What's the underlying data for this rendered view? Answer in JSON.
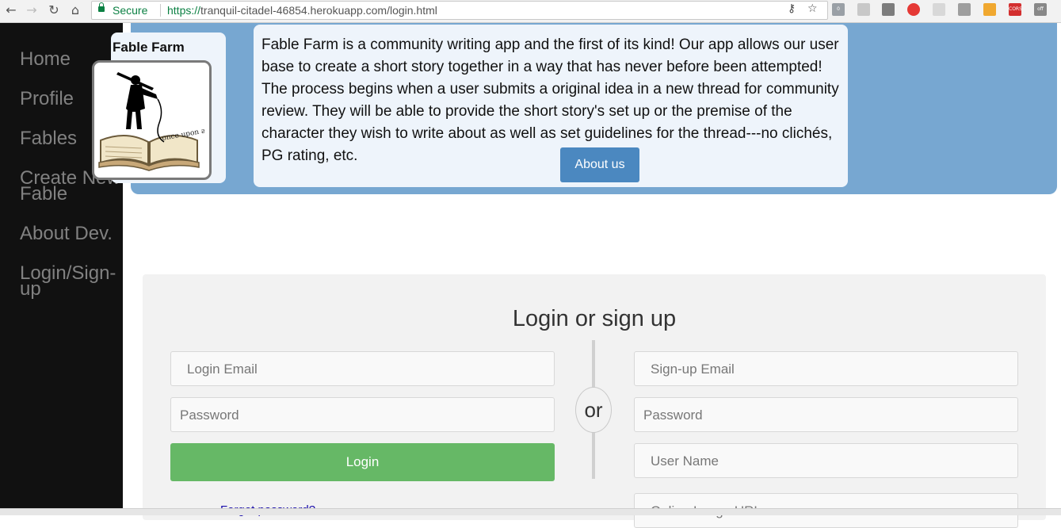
{
  "browser": {
    "secure_label": "Secure",
    "url_scheme": "https://",
    "url_rest": "tranquil-citadel-46854.herokuapp.com/login.html",
    "ext_badge_count": "0",
    "ext_off_label": "off",
    "ext_cors_label": "CORS"
  },
  "sidebar": {
    "items": [
      {
        "label": "Home"
      },
      {
        "label": "Profile"
      },
      {
        "label": "Fables"
      },
      {
        "label": "Create New Fable"
      },
      {
        "label": "About Dev."
      },
      {
        "label": "Login/Sign-up"
      }
    ]
  },
  "header": {
    "logo_title": "Fable Farm",
    "logo_book_text": "once upon a time",
    "description": "Fable Farm is a community writing app and the first of its kind! Our app allows our user base to create a short story together in a way that has never before been attempted! The process begins when a user submits a original idea in a new thread for community review. They will be able to provide the short story's set up or the premise of the character they wish to write about as well as set guidelines for the thread---no clichés, PG rating, etc.",
    "about_button": "About us"
  },
  "login": {
    "title": "Login or sign up",
    "login_email_placeholder": "Login Email",
    "login_password_placeholder": "Password",
    "login_button": "Login",
    "or_label": "or",
    "signup_email_placeholder": "Sign-up Email",
    "signup_password_placeholder": "Password",
    "username_placeholder": "User Name",
    "image_url_placeholder": "Online Image URL",
    "forgot_link": "Forgot password?"
  },
  "colors": {
    "sidebar_bg": "#111111",
    "sidebar_text": "#818181",
    "banner_bg": "#77a7d1",
    "card_bg": "#eef4fb",
    "about_button_bg": "#4b88c0",
    "login_button_bg": "#66b866",
    "panel_bg": "#f2f2f2"
  },
  "icons": [
    "back-arrow-icon",
    "forward-arrow-icon",
    "reload-icon",
    "home-icon",
    "lock-icon",
    "key-icon",
    "star-icon",
    "extension-icons"
  ]
}
